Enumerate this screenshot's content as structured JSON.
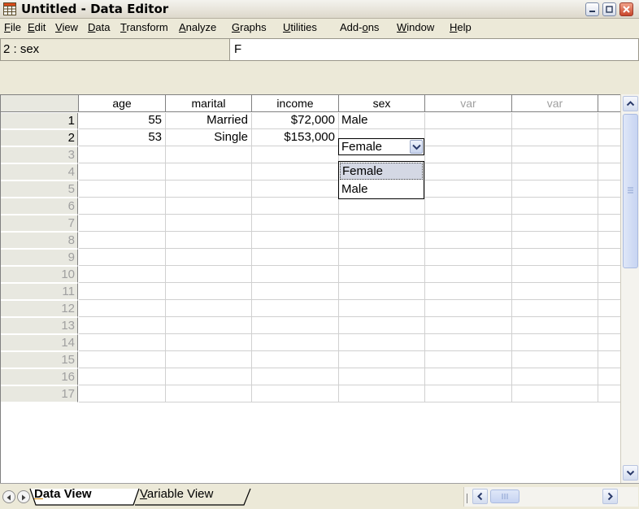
{
  "window": {
    "title": "Untitled - Data Editor"
  },
  "menubar": {
    "items": [
      {
        "label": "File",
        "accel": "F",
        "rest": "ile"
      },
      {
        "label": "Edit",
        "accel": "E",
        "rest": "dit"
      },
      {
        "label": "View",
        "accel": "V",
        "rest": "iew"
      },
      {
        "label": "Data",
        "accel": "D",
        "rest": "ata"
      },
      {
        "label": "Transform",
        "accel": "T",
        "rest": "ransform"
      },
      {
        "label": "Analyze",
        "accel": "A",
        "rest": "nalyze"
      },
      {
        "label": "Graphs",
        "accel": "G",
        "rest": "raphs"
      },
      {
        "label": "Utilities",
        "accel": "U",
        "rest": "tilities"
      },
      {
        "label": "Add-ons",
        "pre": "Add-",
        "accel": "o",
        "rest": "ns"
      },
      {
        "label": "Window",
        "accel": "W",
        "rest": "indow"
      },
      {
        "label": "Help",
        "accel": "H",
        "rest": "elp"
      }
    ]
  },
  "cell_editor": {
    "reference": "2 : sex",
    "value": "F"
  },
  "grid": {
    "columns": [
      "age",
      "marital",
      "income",
      "sex",
      "var",
      "var"
    ],
    "row_numbers": [
      "1",
      "2",
      "3",
      "4",
      "5",
      "6",
      "7",
      "8",
      "9",
      "10",
      "11",
      "12",
      "13",
      "14",
      "15",
      "16",
      "17"
    ],
    "rows": [
      {
        "age": "55",
        "marital": "Married",
        "income": "$72,000",
        "sex": "Male"
      },
      {
        "age": "53",
        "marital": "Single",
        "income": "$153,000",
        "sex": "Female"
      }
    ]
  },
  "dropdown": {
    "selected": "Female",
    "options": [
      "Female",
      "Male"
    ]
  },
  "tabs": {
    "data_view": {
      "accel": "D",
      "rest": "ata View"
    },
    "variable_view": {
      "label": "Variable View",
      "accel": "V",
      "rest": "ariable View"
    }
  },
  "icons": {
    "app": "spss-grid-icon",
    "minimize": "minimize-icon",
    "maximize": "maximize-icon",
    "close": "close-icon"
  },
  "colors": {
    "title_bar_text": "#000000",
    "close_button": "#c8452a",
    "header_fill": "#e8e8e0",
    "dim_text": "#a0a0a0"
  }
}
